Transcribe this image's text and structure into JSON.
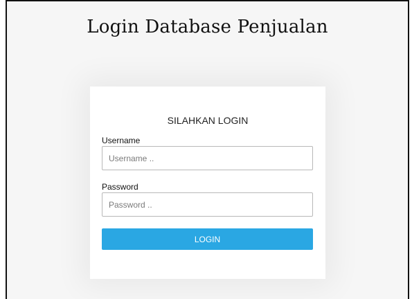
{
  "page": {
    "title": "Login Database Penjualan"
  },
  "login_form": {
    "heading": "SILAHKAN LOGIN",
    "username_label": "Username",
    "username_placeholder": "Username ..",
    "username_value": "",
    "password_label": "Password",
    "password_placeholder": "Password ..",
    "password_value": "",
    "submit_label": "LOGIN"
  },
  "colors": {
    "page_background": "#f6f6f6",
    "card_background": "#ffffff",
    "button_background": "#2aa7e3",
    "button_text": "#ffffff"
  }
}
